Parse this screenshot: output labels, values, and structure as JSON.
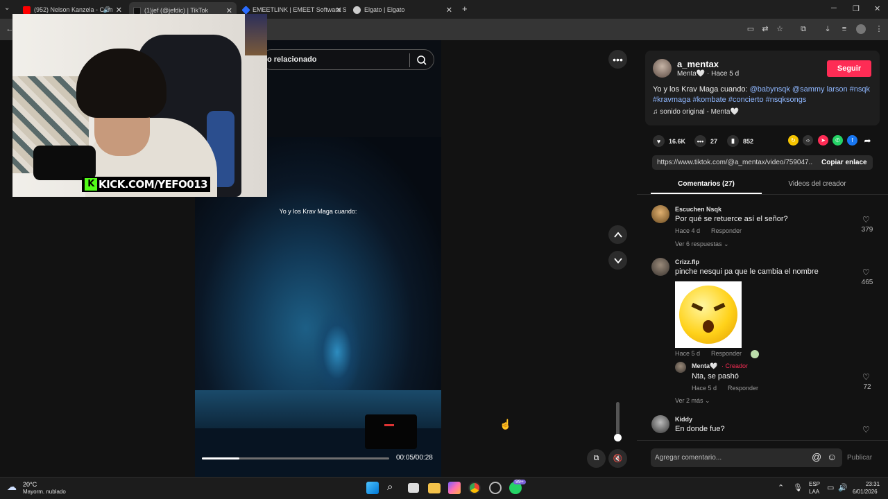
{
  "browser": {
    "tabs": [
      {
        "title": "(952) Nelson Kanzela - Cóm",
        "favicon_color": "#ff0000",
        "active": false
      },
      {
        "title": "(1)jef (@jefdic) | TikTok",
        "favicon_color": "#111111",
        "active": true
      },
      {
        "title": "EMEETLINK | EMEET Software S",
        "favicon_color": "#2a6cff",
        "active": false
      },
      {
        "title": "Elgato | Elgato",
        "favicon_color": "#cccccc",
        "active": false
      }
    ]
  },
  "video": {
    "search_text": "o relacionado",
    "caption": "Yo y los Krav Maga cuando:",
    "time": "00:05/00:28",
    "progress": 0.2
  },
  "webcam": {
    "logo_text": "KICK.COM/YEFO013",
    "logo_k": "K"
  },
  "post": {
    "author": "a_mentax",
    "author_sub": "Menta🤍 · Hace 5 d",
    "follow_label": "Seguir",
    "desc_text": "Yo y los Krav Maga cuando: ",
    "tags_line1": "@babynsqk @sammy larson #nsqk",
    "tags_line2": "#kravmaga #kombate #concierto #nsqksongs",
    "sound": "sonido original - Menta🤍",
    "likes": "16.6K",
    "comments": "27",
    "saves": "852",
    "link": "https://www.tiktok.com/@a_mentax/video/759047...",
    "copy_label": "Copiar enlace",
    "tab_comments": "Comentarios (27)",
    "tab_creator": "Videos del creador"
  },
  "comments": [
    {
      "name": "Escuchen Nsqk",
      "text": "Por qué se retuerce así el señor?",
      "time": "Hace 4 d",
      "reply": "Responder",
      "likes": "379",
      "more": "Ver 6 respuestas"
    },
    {
      "name": "Crizz.flp",
      "text": "pinche nesqui pa que le cambia el nombre",
      "time": "Hace 5 d",
      "reply": "Responder",
      "likes": "465",
      "sub": {
        "name": "Menta🤍",
        "badge": "Creador",
        "text": "Nta, se pashó",
        "time": "Hace 5 d",
        "reply": "Responder",
        "likes": "72"
      },
      "more": "Ver 2 más"
    },
    {
      "name": "Kiddy",
      "text": "En donde fue?"
    }
  ],
  "comment_box": {
    "placeholder": "Agregar comentario...",
    "post": "Publicar"
  },
  "taskbar": {
    "temp": "20°C",
    "weather": "Mayorm. nublado",
    "lang1": "ESP",
    "lang2": "LAA",
    "time": "23:31",
    "date": "6/01/2026",
    "whatsapp_badge": "99+"
  },
  "colors": {
    "accent": "#fe2c55",
    "tag": "#8fb7ff",
    "kick": "#53fc18"
  }
}
